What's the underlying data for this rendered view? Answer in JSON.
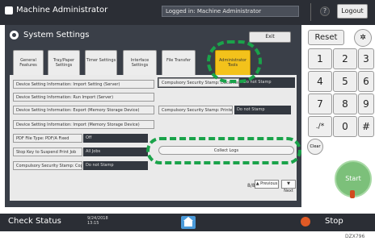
{
  "header": {
    "app_title": "Machine Administrator",
    "logged_in": "Logged in: Machine Administrator",
    "help": "?",
    "logout": "Logout"
  },
  "panel": {
    "title": "System Settings",
    "exit": "Exit"
  },
  "tabs": [
    {
      "label": "General Features"
    },
    {
      "label": "Tray/Paper Settings"
    },
    {
      "label": "Timer Settings"
    },
    {
      "label": "Interface Settings"
    },
    {
      "label": "File Transfer"
    },
    {
      "label": "Administrator Tools",
      "active": true
    }
  ],
  "settings": {
    "left": [
      "Device Setting Information: Import Setting (Server)",
      "Device Setting Information: Run Import (Server)",
      "Device Setting Information: Export (Memory Storage Device)",
      "Device Setting Information: Import (Memory Storage Device)",
      "PDF File Type: PDF/A Fixed",
      "Stop Key to Suspend Print Job",
      "Compulsory Security Stamp: Copier"
    ],
    "left_values": [
      "",
      "",
      "",
      "",
      "Off",
      "All Jobs",
      "Do not Stamp"
    ],
    "right": [
      {
        "label": "Compulsory Security Stamp: Document Server",
        "value": "Do not Stamp"
      },
      {
        "label": "Compulsory Security Stamp: Printer",
        "value": "Do not Stamp"
      },
      {
        "label": "Collect Logs",
        "value": ""
      }
    ]
  },
  "pagination": {
    "page": "8/8",
    "prev": "Previous",
    "next": "Next"
  },
  "keypad": {
    "reset": "Reset",
    "keys": [
      "1",
      "2",
      "3",
      "4",
      "5",
      "6",
      "7",
      "8",
      "9",
      "./*",
      "0",
      "#"
    ],
    "clear": "Clear",
    "start": "Start"
  },
  "footer": {
    "check_status": "Check Status",
    "clock_date": "9/24/2018",
    "clock_time": "13:15",
    "stop": "Stop"
  },
  "figure_code": "DZX796",
  "colors": {
    "highlight": "#1aa34a",
    "active_tab": "#f3c21b",
    "start": "#7cc07a"
  }
}
